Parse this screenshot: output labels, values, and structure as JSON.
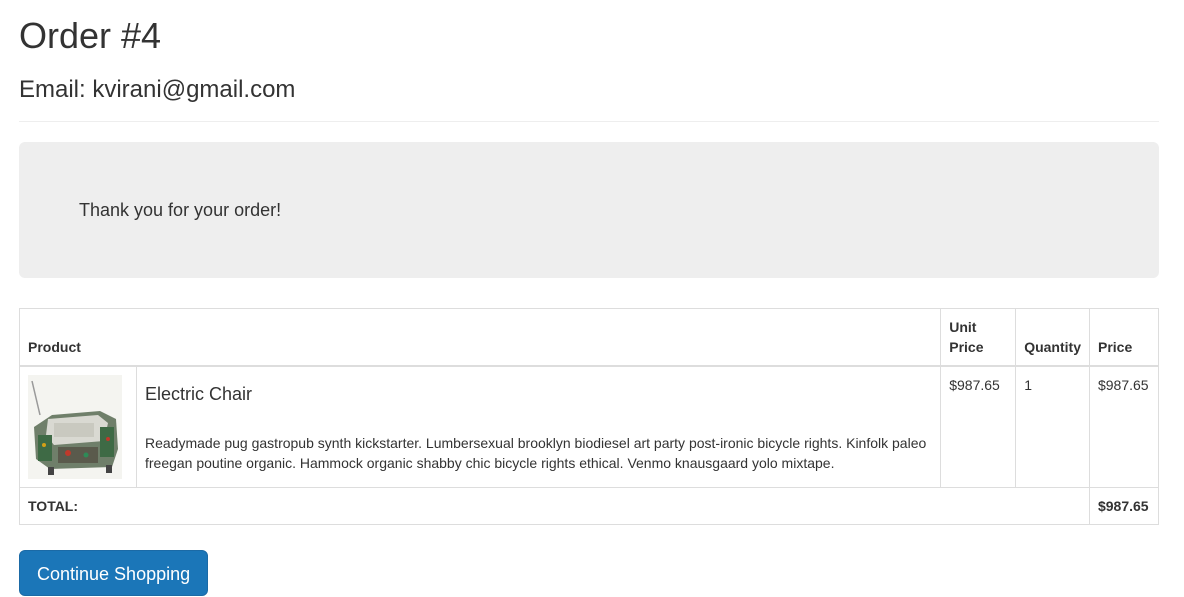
{
  "header": {
    "title": "Order #4",
    "email_line": "Email: kvirani@gmail.com"
  },
  "notice": {
    "message": "Thank you for your order!"
  },
  "table": {
    "columns": {
      "product": "Product",
      "unit_price": "Unit Price",
      "quantity": "Quantity",
      "price": "Price"
    },
    "rows": [
      {
        "name": "Electric Chair",
        "description": "Readymade pug gastropub synth kickstarter. Lumbersexual brooklyn biodiesel art party post-ironic bicycle rights. Kinfolk paleo freegan poutine organic. Hammock organic shabby chic bicycle rights ethical. Venmo knausgaard yolo mixtape.",
        "unit_price": "$987.65",
        "quantity": "1",
        "price": "$987.65",
        "image_icon": "product-thumbnail"
      }
    ],
    "total_label": "TOTAL:",
    "total_value": "$987.65"
  },
  "actions": {
    "continue_label": "Continue Shopping"
  },
  "colors": {
    "primary": "#1b76b8",
    "jumbotron_bg": "#eeeeee",
    "text": "#333333"
  }
}
